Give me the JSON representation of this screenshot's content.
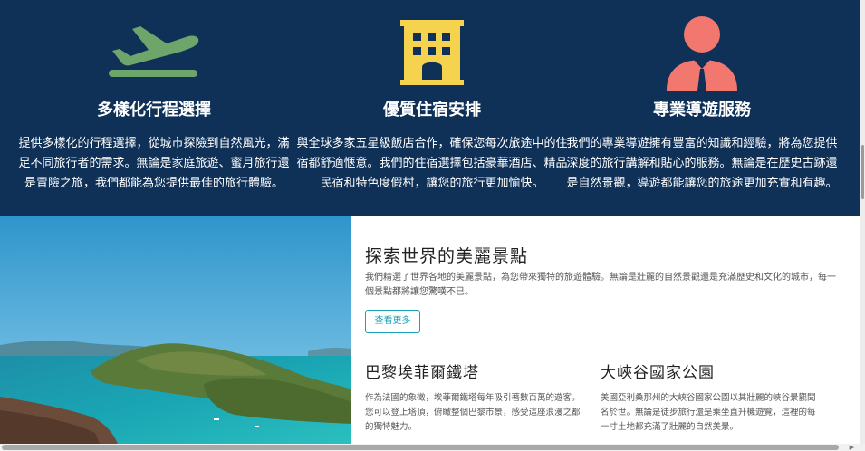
{
  "features": [
    {
      "icon": "airplane-icon",
      "title": "多樣化行程選擇",
      "text": "提供多樣化的行程選擇，從城市探險到自然風光，滿足不同旅行者的需求。無論是家庭旅遊、蜜月旅行還是冒險之旅，我們都能為您提供最佳的旅行體驗。",
      "color": "#6ea56a"
    },
    {
      "icon": "hotel-icon",
      "title": "優質住宿安排",
      "text": "與全球多家五星級飯店合作，確保您每次旅途中的住宿都舒適愜意。我們的住宿選擇包括豪華酒店、精品民宿和特色度假村，讓您的旅行更加愉快。",
      "color": "#f5d34f"
    },
    {
      "icon": "tour-guide-icon",
      "title": "專業導遊服務",
      "text": "我們的專業導遊擁有豐富的知識和經驗，將為您提供深度的旅行講解和貼心的服務。無論是在歷史古跡還是自然景觀，導遊都能讓您的旅途更加充實和有趣。",
      "color": "#f2776f"
    }
  ],
  "explore": {
    "title": "探索世界的美麗景點",
    "intro": "我們精選了世界各地的美麗景點，為您帶來獨特的旅遊體驗。無論是壯麗的自然景觀還是充滿歷史和文化的城市，每一個景點都將讓您驚嘆不已。",
    "button_label": "查看更多",
    "accent": "#17a2b8"
  },
  "spots": [
    {
      "title": "巴黎埃菲爾鐵塔",
      "text": "作為法國的象徵，埃菲爾鐵塔每年吸引著數百萬的遊客。您可以登上塔頂，俯瞰整個巴黎市景，感受這座浪漫之都的獨特魅力。"
    },
    {
      "title": "大峽谷國家公園",
      "text": "美國亞利桑那州的大峽谷國家公園以其壯麗的峽谷景觀聞名於世。無論是徒步旅行還是乘坐直升機遊覽，這裡的每一寸土地都充滿了壯麗的自然美景。"
    }
  ],
  "theme": {
    "banner_bg": "#0f3057",
    "heading_text": "#222222",
    "body_text": "#555555"
  },
  "image": {
    "alt": "island-bay-photo"
  }
}
